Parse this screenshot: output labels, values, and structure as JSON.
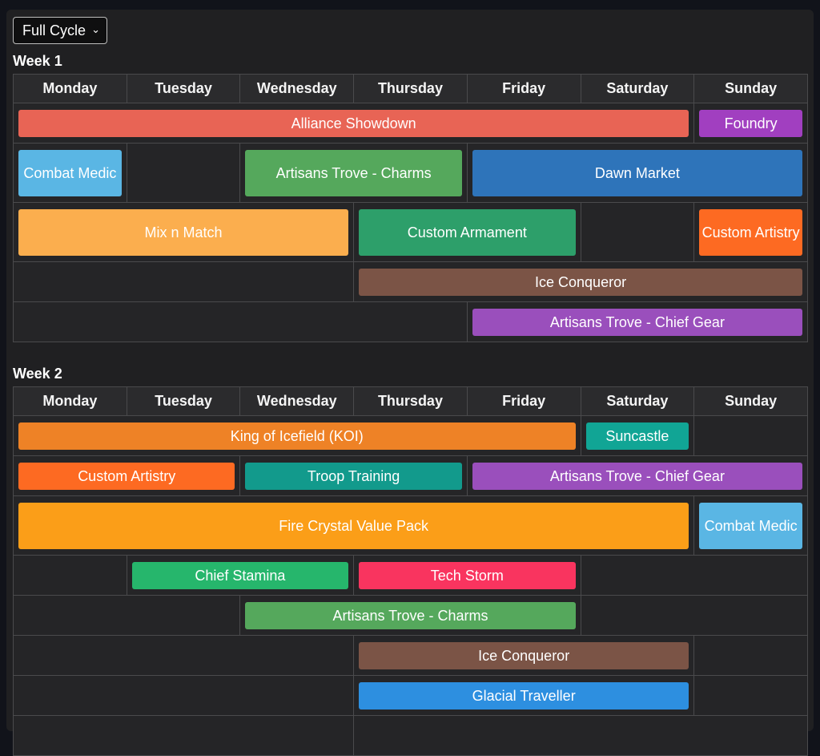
{
  "cycle_select": {
    "value": "Full Cycle"
  },
  "days": [
    "Monday",
    "Tuesday",
    "Wednesday",
    "Thursday",
    "Friday",
    "Saturday",
    "Sunday"
  ],
  "weeks": [
    {
      "title": "Week 1",
      "rows": [
        {
          "h": 50,
          "cells": [
            {
              "span": 6,
              "event": {
                "label": "Alliance Showdown",
                "color": "#e86455"
              }
            },
            {
              "span": 1,
              "event": {
                "label": "Foundry",
                "color": "#a13fc0"
              }
            }
          ]
        },
        {
          "h": 74,
          "cells": [
            {
              "span": 1,
              "event": {
                "label": "Combat Medic",
                "color": "#5ab6e4"
              }
            },
            {
              "span": 1
            },
            {
              "span": 2,
              "event": {
                "label": "Artisans Trove - Charms",
                "color": "#55a85c"
              }
            },
            {
              "span": 3,
              "event": {
                "label": "Dawn Market",
                "color": "#2e74ba"
              }
            }
          ]
        },
        {
          "h": 74,
          "cells": [
            {
              "span": 3,
              "event": {
                "label": "Mix n Match",
                "color": "#fbae4e"
              }
            },
            {
              "span": 2,
              "event": {
                "label": "Custom Armament",
                "color": "#2d9f6a"
              }
            },
            {
              "span": 1
            },
            {
              "span": 1,
              "event": {
                "label": "Custom Artistry",
                "color": "#fd6a22"
              }
            }
          ]
        },
        {
          "h": 50,
          "cells": [
            {
              "span": 3
            },
            {
              "span": 4,
              "event": {
                "label": "Ice Conqueror",
                "color": "#7b5446"
              }
            }
          ]
        },
        {
          "h": 50,
          "cells": [
            {
              "span": 4
            },
            {
              "span": 3,
              "event": {
                "label": "Artisans Trove - Chief Gear",
                "color": "#9a4fbc"
              }
            }
          ]
        }
      ]
    },
    {
      "title": "Week 2",
      "rows": [
        {
          "h": 50,
          "cells": [
            {
              "span": 5,
              "event": {
                "label": "King of Icefield (KOI)",
                "color": "#ee8226"
              }
            },
            {
              "span": 1,
              "event": {
                "label": "Suncastle",
                "color": "#11a595"
              }
            },
            {
              "span": 1
            }
          ]
        },
        {
          "h": 50,
          "cells": [
            {
              "span": 2,
              "event": {
                "label": "Custom Artistry",
                "color": "#fd6a22"
              }
            },
            {
              "span": 2,
              "event": {
                "label": "Troop Training",
                "color": "#129a8c"
              }
            },
            {
              "span": 3,
              "event": {
                "label": "Artisans Trove - Chief Gear",
                "color": "#9a4fbc"
              }
            }
          ]
        },
        {
          "h": 74,
          "cells": [
            {
              "span": 6,
              "event": {
                "label": "Fire Crystal Value Pack",
                "color": "#fb9e18"
              }
            },
            {
              "span": 1,
              "event": {
                "label": "Combat Medic",
                "color": "#5ab6e4"
              }
            }
          ]
        },
        {
          "h": 50,
          "cells": [
            {
              "span": 1
            },
            {
              "span": 2,
              "event": {
                "label": "Chief Stamina",
                "color": "#26b66c"
              }
            },
            {
              "span": 2,
              "event": {
                "label": "Tech Storm",
                "color": "#f9345f"
              }
            },
            {
              "span": 2
            }
          ]
        },
        {
          "h": 50,
          "cells": [
            {
              "span": 2
            },
            {
              "span": 3,
              "event": {
                "label": "Artisans Trove - Charms",
                "color": "#55a85c"
              }
            },
            {
              "span": 2
            }
          ]
        },
        {
          "h": 50,
          "cells": [
            {
              "span": 3
            },
            {
              "span": 3,
              "event": {
                "label": "Ice Conqueror",
                "color": "#7b5446"
              }
            },
            {
              "span": 1
            }
          ]
        },
        {
          "h": 50,
          "cells": [
            {
              "span": 3
            },
            {
              "span": 3,
              "event": {
                "label": "Glacial Traveller",
                "color": "#2d8fe0"
              }
            },
            {
              "span": 1
            }
          ]
        },
        {
          "h": 50,
          "cells": [
            {
              "span": 3
            },
            {
              "span": 4
            }
          ]
        }
      ]
    }
  ]
}
